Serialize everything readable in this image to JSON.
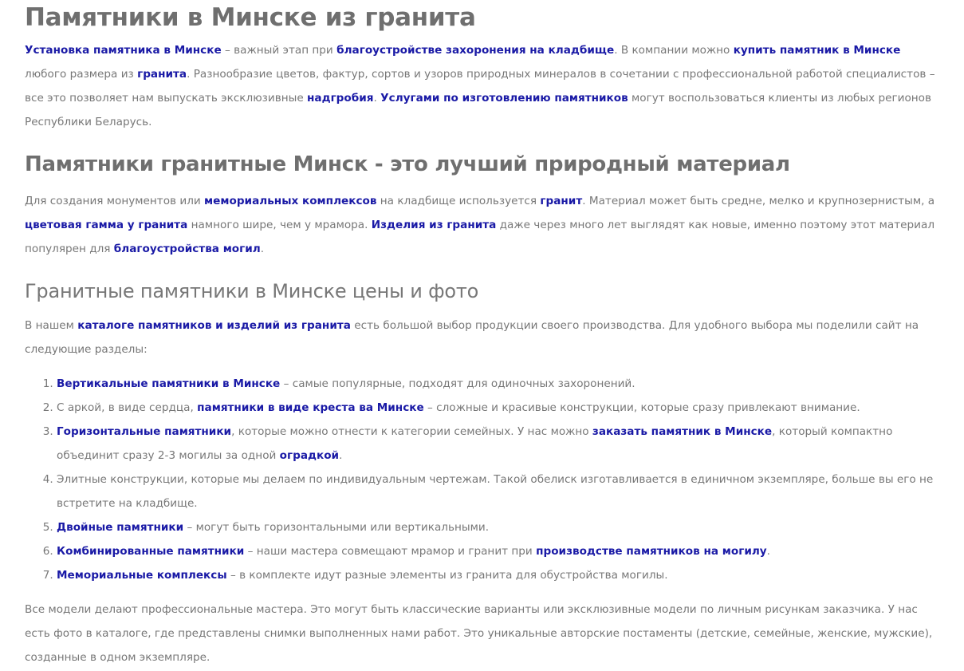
{
  "title": "Памятники в Минске из гранита",
  "p1": {
    "l1": "Установка памятника в Минске",
    "t1": " – важный этап при ",
    "l2": "благоустройстве захоронения на кладбище",
    "t2": ". В компании можно ",
    "l3": "купить памятник в Минске",
    "t3": " любого размера из ",
    "l4": "гранита",
    "t4": ". Разнообразие цветов, фактур, сортов и узоров природных минералов в сочетании с профессиональной работой специалистов – все это позволяет нам выпускать эксклюзивные ",
    "l5": "надгробия",
    "t5": ". ",
    "l6": "Услугами по изготовлению памятников",
    "t6": " могут воспользоваться клиенты из любых регионов Республики Беларусь."
  },
  "h2": "Памятники гранитные Минск - это лучший природный материал",
  "p2": {
    "t1": "Для создания монументов или ",
    "l1": "мемориальных комплексов",
    "t2": " на кладбище используется ",
    "l2": "гранит",
    "t3": ". Материал может быть средне, мелко и крупнозернистым, а ",
    "l3": "цветовая гамма у гранита",
    "t4": " намного шире, чем у мрамора.  ",
    "l4": "Изделия из гранита",
    "t5": " даже через много лет выглядят как новые, именно поэтому этот материал популярен для ",
    "l5": "благоустройства могил",
    "t6": "."
  },
  "h3": "Гранитные памятники в Минске цены и фото",
  "p3": {
    "t1": "В нашем ",
    "l1": "каталоге памятников и изделий из гранита",
    "t2": " есть большой выбор продукции своего производства. Для удобного выбора мы поделили сайт на следующие разделы:"
  },
  "list": {
    "i1": {
      "l1": "Вертикальные памятники в Минске",
      "t1": " – самые популярные, подходят для одиночных захоронений."
    },
    "i2": {
      "t0": "С аркой, в виде сердца, ",
      "l1": "памятники в виде креста ва Минске",
      "t1": " – сложные и красивые конструкции, которые сразу привлекают внимание."
    },
    "i3": {
      "l1": "Горизонтальные памятники",
      "t1": ", которые можно отнести к категории семейных. У нас можно ",
      "l2": "заказать памятник в Минске",
      "t2": ", который компактно объединит сразу 2-3 могилы за одной ",
      "l3": "оградкой",
      "t3": "."
    },
    "i4": {
      "t0": "Элитные конструкции, которые мы делаем по индивидуальным чертежам. Такой обелиск изготавливается в единичном экземпляре, больше вы его не встретите на кладбище."
    },
    "i5": {
      "l1": "Двойные памятники",
      "t1": " – могут быть горизонтальными или вертикальными."
    },
    "i6": {
      "l1": "Комбинированные памятники",
      "t1": " – наши мастера совмещают мрамор и гранит при ",
      "l2": "производстве памятников на могилу",
      "t2": "."
    },
    "i7": {
      "l1": "Мемориальные комплексы",
      "t1": " – в комплекте идут разные элементы из гранита для обустройства могилы."
    }
  },
  "p4": {
    "line1": "Все модели делают профессиональные мастера. Это могут быть классические варианты или эксклюзивные модели по личным рисункам заказчика. У нас",
    "line2": "есть фото в каталоге, где представлены снимки выполненных нами работ. Это уникальные авторские постаменты (детские, семейные, женские, мужские),",
    "line3": "созданные в одном экземпляре."
  }
}
